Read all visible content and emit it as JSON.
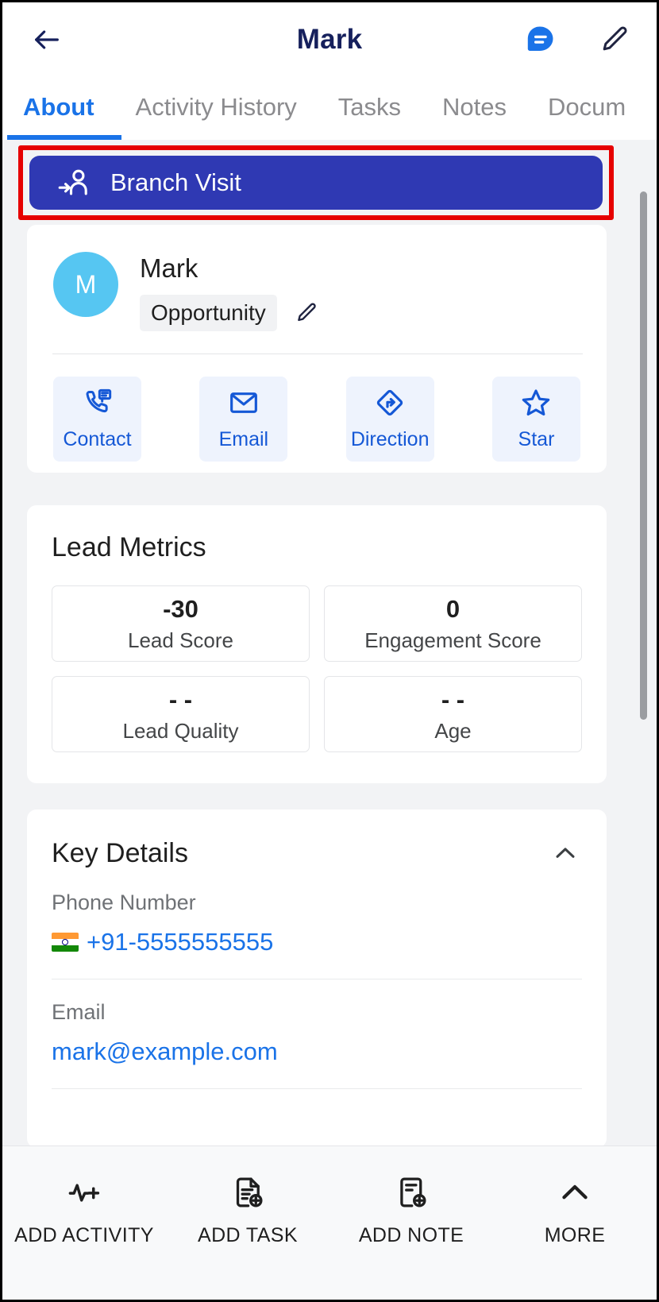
{
  "header": {
    "title": "Mark",
    "back_icon": "arrow-left-icon",
    "message_icon": "chat-bubble-icon",
    "edit_icon": "pencil-icon"
  },
  "tabs": [
    {
      "label": "About",
      "active": true
    },
    {
      "label": "Activity History",
      "active": false
    },
    {
      "label": "Tasks",
      "active": false
    },
    {
      "label": "Notes",
      "active": false
    },
    {
      "label": "Docum",
      "active": false
    }
  ],
  "branch_visit": {
    "label": "Branch Visit",
    "icon": "user-check-in-icon",
    "background": "#2f39b3",
    "highlighted": true,
    "highlight_color": "#e60000"
  },
  "profile": {
    "avatar_initial": "M",
    "avatar_color": "#56c6f2",
    "name": "Mark",
    "badge": "Opportunity",
    "badge_edit_icon": "pencil-icon",
    "actions": [
      {
        "label": "Contact",
        "icon": "phone-message-icon"
      },
      {
        "label": "Email",
        "icon": "envelope-icon"
      },
      {
        "label": "Direction",
        "icon": "directions-icon"
      },
      {
        "label": "Star",
        "icon": "star-icon"
      }
    ],
    "action_color": "#1558d6"
  },
  "lead_metrics": {
    "title": "Lead Metrics",
    "items": [
      {
        "value": "-30",
        "label": "Lead Score"
      },
      {
        "value": "0",
        "label": "Engagement Score"
      },
      {
        "value": "- -",
        "label": "Lead Quality"
      },
      {
        "value": "- -",
        "label": "Age"
      }
    ]
  },
  "key_details": {
    "title": "Key Details",
    "collapse_icon": "chevron-up-icon",
    "expanded": true,
    "fields": [
      {
        "label": "Phone Number",
        "value": "+91-5555555555",
        "flag": "india-flag-icon",
        "link_color": "#1a73e8"
      },
      {
        "label": "Email",
        "value": "mark@example.com",
        "link_color": "#1a73e8"
      }
    ]
  },
  "bottom_bar": {
    "items": [
      {
        "label": "ADD ACTIVITY",
        "icon": "activity-plus-icon"
      },
      {
        "label": "ADD TASK",
        "icon": "document-plus-icon"
      },
      {
        "label": "ADD NOTE",
        "icon": "note-plus-icon"
      },
      {
        "label": "MORE",
        "icon": "chevron-up-icon"
      }
    ]
  }
}
